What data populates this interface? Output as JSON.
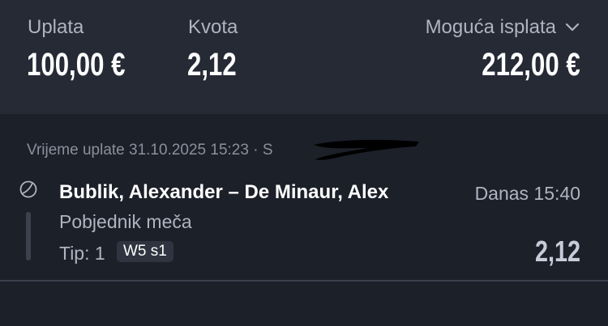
{
  "summary": {
    "stake_label": "Uplata",
    "stake_value": "100,00 €",
    "odds_label": "Kvota",
    "odds_value": "2,12",
    "payout_label": "Moguća isplata",
    "payout_value": "212,00 €",
    "payout_chevron_icon": "chevron-down-icon"
  },
  "bet": {
    "placed_time": "Vrijeme uplate 31.10.2025 15:23 · S",
    "sport_icon": "tennis-ball-icon",
    "match": "Bublik, Alexander – De Minaur, Alex",
    "start_time": "Danas 15:40",
    "market": "Pobjednik meča",
    "tip": "Tip: 1",
    "badge": "W5 s1",
    "odd": "2,12"
  },
  "colors": {
    "background": "#1c2029",
    "summary_background": "#252a35",
    "text_primary": "#ffffff",
    "text_secondary": "#aeb4c0"
  }
}
